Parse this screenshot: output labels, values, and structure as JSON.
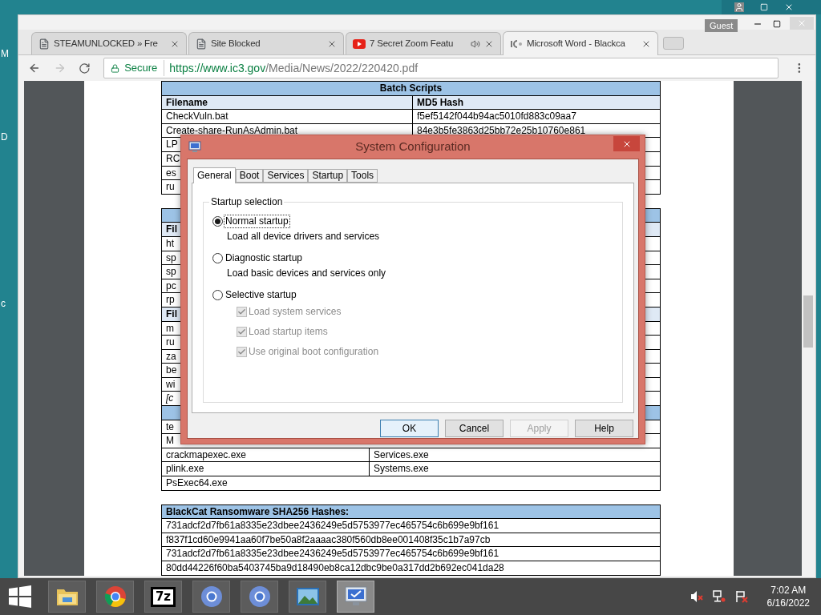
{
  "desktop": {
    "labels": [
      "M",
      "D",
      "c"
    ]
  },
  "browser": {
    "profile": "Guest",
    "tabs": [
      {
        "title": "STEAMUNLOCKED » Fre",
        "kind": "page",
        "audio": false,
        "selected": false
      },
      {
        "title": "Site Blocked",
        "kind": "page",
        "audio": false,
        "selected": false
      },
      {
        "title": "7 Secret Zoom Featu",
        "kind": "video",
        "audio": true,
        "selected": false
      },
      {
        "title": "Microsoft Word - Blackca",
        "kind": "seal",
        "audio": false,
        "selected": true
      }
    ],
    "address": {
      "security": "Secure",
      "host": "https://www.ic3.gov",
      "path": "/Media/News/2022/220420.pdf"
    }
  },
  "document": {
    "tables": [
      {
        "rows": [
          {
            "kind": "title",
            "cells": [
              "Batch Scripts"
            ]
          },
          {
            "kind": "header",
            "cells": [
              "Filename",
              "MD5 Hash"
            ]
          },
          {
            "kind": "row",
            "cells": [
              "CheckVuln.bat",
              "f5ef5142f044b94ac5010fd883c09aa7"
            ]
          },
          {
            "kind": "row",
            "cells": [
              "Create-share-RunAsAdmin.bat",
              "84e3b5fe3863d25bb72e25b10760e861"
            ]
          },
          {
            "kind": "row",
            "cells": [
              "LP"
            ]
          },
          {
            "kind": "row",
            "cells": [
              "RC"
            ]
          },
          {
            "kind": "row",
            "cells": [
              "es"
            ]
          },
          {
            "kind": "row",
            "cells": [
              "ru"
            ]
          }
        ]
      },
      {
        "rows": [
          {
            "kind": "title"
          },
          {
            "kind": "header",
            "cells": [
              "Fil"
            ]
          },
          {
            "kind": "row",
            "cells": [
              "ht"
            ]
          },
          {
            "kind": "row",
            "cells": [
              "sp"
            ]
          },
          {
            "kind": "row",
            "cells": [
              "sp"
            ]
          },
          {
            "kind": "row",
            "cells": [
              "pc"
            ]
          },
          {
            "kind": "row",
            "cells": [
              "rp"
            ]
          },
          {
            "kind": "header",
            "cells": [
              "Fil"
            ]
          },
          {
            "kind": "row",
            "cells": [
              "m"
            ]
          },
          {
            "kind": "row",
            "cells": [
              "ru"
            ]
          },
          {
            "kind": "row",
            "cells": [
              "za"
            ]
          },
          {
            "kind": "row",
            "cells": [
              "be"
            ]
          },
          {
            "kind": "row",
            "cells": [
              "wi"
            ]
          },
          {
            "kind": "note",
            "cells": [
              "[c"
            ]
          },
          {
            "kind": "title"
          },
          {
            "kind": "row",
            "cells": [
              "te"
            ]
          },
          {
            "kind": "row",
            "cells": [
              "M"
            ]
          },
          {
            "kind": "row",
            "cells": [
              "crackmapexec.exe",
              "Services.exe"
            ]
          },
          {
            "kind": "row",
            "cells": [
              "plink.exe",
              "Systems.exe"
            ]
          },
          {
            "kind": "row",
            "cells": [
              "PsExec64.exe"
            ]
          }
        ]
      },
      {
        "rows": [
          {
            "kind": "caption",
            "cells": [
              "BlackCat Ransomware SHA256 Hashes:"
            ]
          },
          {
            "kind": "row",
            "cells": [
              "731adcf2d7fb61a8335e23dbee2436249e5d5753977ec465754c6b699e9bf161"
            ]
          },
          {
            "kind": "row",
            "cells": [
              "f837f1cd60e9941aa60f7be50a8f2aaaac380f560db8ee001408f35c1b7a97cb"
            ]
          },
          {
            "kind": "row",
            "cells": [
              "731adcf2d7fb61a8335e23dbee2436249e5d5753977ec465754c6b699e9bf161"
            ]
          },
          {
            "kind": "row",
            "cells": [
              "80dd44226f60ba5403745ba9d18490eb8ca12dbc9be0a317dd2b692ec041da28"
            ]
          }
        ]
      }
    ]
  },
  "dialog": {
    "title": "System Configuration",
    "tabs": [
      {
        "label": "General",
        "selected": true
      },
      {
        "label": "Boot",
        "selected": false
      },
      {
        "label": "Services",
        "selected": false
      },
      {
        "label": "Startup",
        "selected": false
      },
      {
        "label": "Tools",
        "selected": false
      }
    ],
    "group": "Startup selection",
    "options": [
      {
        "label": "Normal startup",
        "description": "Load all device drivers and services",
        "selected": true
      },
      {
        "label": "Diagnostic startup",
        "description": "Load basic devices and services only",
        "selected": false
      },
      {
        "label": "Selective startup",
        "selected": false
      }
    ],
    "suboptions": [
      {
        "label": "Load system services",
        "checked": true,
        "disabled": true
      },
      {
        "label": "Load startup items",
        "checked": true,
        "disabled": true
      },
      {
        "label": "Use original boot configuration",
        "checked": true,
        "disabled": true
      }
    ],
    "buttons": [
      {
        "label": "OK",
        "default": true,
        "disabled": false
      },
      {
        "label": "Cancel",
        "default": false,
        "disabled": false
      },
      {
        "label": "Apply",
        "default": false,
        "disabled": true
      },
      {
        "label": "Help",
        "default": false,
        "disabled": false
      }
    ]
  },
  "taskbar": {
    "apps": [
      {
        "kind": "folder",
        "active": false
      },
      {
        "kind": "chrome",
        "active": false
      },
      {
        "kind": "archiver",
        "label": "7z",
        "active": false
      },
      {
        "kind": "chromium",
        "active": false
      },
      {
        "kind": "chromium",
        "active": false
      },
      {
        "kind": "photos",
        "active": false
      },
      {
        "kind": "monitor",
        "active": true
      }
    ],
    "time": "7:02 AM",
    "date": "6/16/2022"
  }
}
